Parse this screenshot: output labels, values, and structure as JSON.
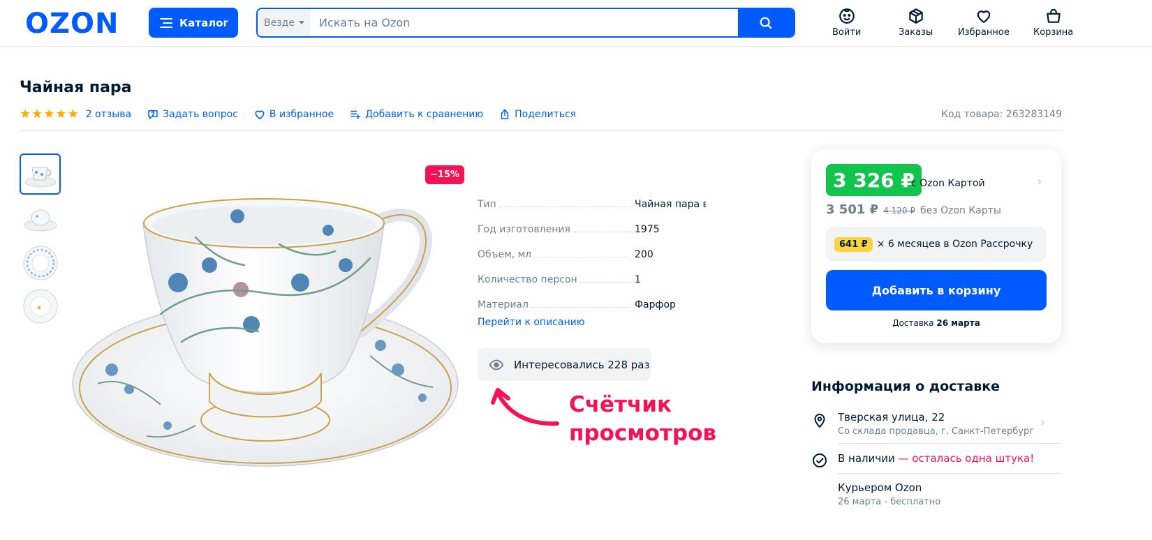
{
  "header": {
    "logo": "OZON",
    "catalog_label": "Каталог",
    "search_scope": "Везде",
    "search_placeholder": "Искать на Ozon",
    "nav": [
      {
        "label": "Войти",
        "icon": "user-face-icon"
      },
      {
        "label": "Заказы",
        "icon": "box-icon"
      },
      {
        "label": "Избранное",
        "icon": "heart-icon"
      },
      {
        "label": "Корзина",
        "icon": "bag-icon"
      }
    ]
  },
  "product": {
    "title": "Чайная пара",
    "rating_stars": 5,
    "reviews": "2 отзыва",
    "ask_question": "Задать вопрос",
    "favorite": "В избранное",
    "compare": "Добавить к сравнению",
    "share": "Поделиться",
    "sku": "Код товара: 263283149",
    "discount_badge": "−15%",
    "specs": [
      {
        "key": "Тип",
        "value": "Чайная пара в"
      },
      {
        "key": "Год изготовления",
        "value": "1975"
      },
      {
        "key": "Объем, мл",
        "value": "200"
      },
      {
        "key": "Количество персон",
        "value": "1"
      },
      {
        "key": "Материал",
        "value": "Фарфор"
      }
    ],
    "goto_description": "Перейти к описанию",
    "views_text": "Интересовались 228 раз",
    "callout_line1": "Счётчик",
    "callout_line2": "просмотров"
  },
  "price_card": {
    "card_price": "3 326 ₽",
    "card_price_note": "с Ozon Картой",
    "regular_price": "3 501 ₽",
    "old_price": "4 120 ₽",
    "regular_note": "без Ozon Карты",
    "installment_badge": "641 ₽",
    "installment_text": "× 6 месяцев в Ozon Рассрочку",
    "add_to_cart": "Добавить в корзину",
    "delivery_prefix": "Доставка",
    "delivery_date": "26 марта"
  },
  "delivery": {
    "title": "Информация о доставке",
    "address": "Тверская улица, 22",
    "address_sub": "Со склада продавца, г. Санкт-Петербург",
    "stock": "В наличии",
    "stock_warning": "— осталась одна штука!",
    "courier": "Курьером Ozon",
    "courier_sub": "26 марта - бесплатно"
  },
  "colors": {
    "brand_blue": "#005bff",
    "price_green": "#10c44c",
    "accent_pink": "#f91155",
    "installment_yellow": "#ffd43b"
  }
}
